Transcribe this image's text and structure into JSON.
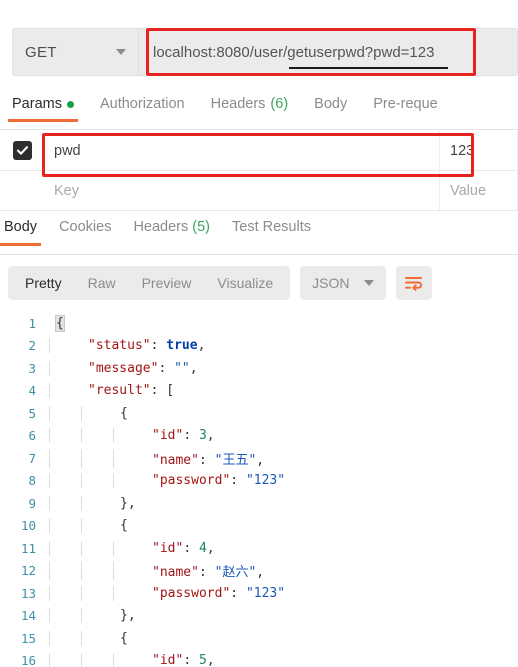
{
  "request": {
    "method": "GET",
    "method_caret_icon": "chevron-down-icon",
    "url": "localhost:8080/user/getuserpwd?pwd=123",
    "annotation_color": "#e8231f"
  },
  "request_tabs": [
    {
      "label": "Params",
      "badge": "",
      "dot": true,
      "active": true
    },
    {
      "label": "Authorization",
      "badge": "",
      "dot": false,
      "active": false
    },
    {
      "label": "Headers",
      "badge": "(6)",
      "dot": false,
      "active": false
    },
    {
      "label": "Body",
      "badge": "",
      "dot": false,
      "active": false
    },
    {
      "label": "Pre-reque",
      "badge": "",
      "dot": false,
      "active": false
    }
  ],
  "params": {
    "rows": [
      {
        "checked": true,
        "key": "pwd",
        "value": "123",
        "placeholder": false
      },
      {
        "checked": false,
        "key": "Key",
        "value": "Value",
        "placeholder": true
      }
    ]
  },
  "response_tabs": [
    {
      "label": "Body",
      "badge": "",
      "active": true
    },
    {
      "label": "Cookies",
      "badge": "",
      "active": false
    },
    {
      "label": "Headers",
      "badge": "(5)",
      "active": false
    },
    {
      "label": "Test Results",
      "badge": "",
      "active": false
    }
  ],
  "format_toolbar": {
    "views": [
      {
        "label": "Pretty",
        "active": true
      },
      {
        "label": "Raw",
        "active": false
      },
      {
        "label": "Preview",
        "active": false
      },
      {
        "label": "Visualize",
        "active": false
      }
    ],
    "language": "JSON",
    "language_caret_icon": "chevron-down-icon",
    "wrap_icon": "wrap-text-icon",
    "wrap_icon_color": "#ef6c35"
  },
  "code": {
    "lines": [
      {
        "n": "1",
        "indent": 0,
        "tokens": [
          {
            "t": "{",
            "c": "p",
            "hl": true
          }
        ]
      },
      {
        "n": "2",
        "indent": 1,
        "tokens": [
          {
            "t": "\"status\"",
            "c": "key"
          },
          {
            "t": ": ",
            "c": "p"
          },
          {
            "t": "true",
            "c": "bool"
          },
          {
            "t": ",",
            "c": "p"
          }
        ]
      },
      {
        "n": "3",
        "indent": 1,
        "tokens": [
          {
            "t": "\"message\"",
            "c": "key"
          },
          {
            "t": ": ",
            "c": "p"
          },
          {
            "t": "\"\"",
            "c": "str"
          },
          {
            "t": ",",
            "c": "p"
          }
        ]
      },
      {
        "n": "4",
        "indent": 1,
        "tokens": [
          {
            "t": "\"result\"",
            "c": "key"
          },
          {
            "t": ": ",
            "c": "p"
          },
          {
            "t": "[",
            "c": "p"
          }
        ]
      },
      {
        "n": "5",
        "indent": 2,
        "tokens": [
          {
            "t": "{",
            "c": "p"
          }
        ]
      },
      {
        "n": "6",
        "indent": 3,
        "tokens": [
          {
            "t": "\"id\"",
            "c": "key"
          },
          {
            "t": ": ",
            "c": "p"
          },
          {
            "t": "3",
            "c": "num"
          },
          {
            "t": ",",
            "c": "p"
          }
        ]
      },
      {
        "n": "7",
        "indent": 3,
        "tokens": [
          {
            "t": "\"name\"",
            "c": "key"
          },
          {
            "t": ": ",
            "c": "p"
          },
          {
            "t": "\"王五\"",
            "c": "str"
          },
          {
            "t": ",",
            "c": "p"
          }
        ]
      },
      {
        "n": "8",
        "indent": 3,
        "tokens": [
          {
            "t": "\"password\"",
            "c": "key"
          },
          {
            "t": ": ",
            "c": "p"
          },
          {
            "t": "\"123\"",
            "c": "str"
          }
        ]
      },
      {
        "n": "9",
        "indent": 2,
        "tokens": [
          {
            "t": "},",
            "c": "p"
          }
        ]
      },
      {
        "n": "10",
        "indent": 2,
        "tokens": [
          {
            "t": "{",
            "c": "p"
          }
        ]
      },
      {
        "n": "11",
        "indent": 3,
        "tokens": [
          {
            "t": "\"id\"",
            "c": "key"
          },
          {
            "t": ": ",
            "c": "p"
          },
          {
            "t": "4",
            "c": "num"
          },
          {
            "t": ",",
            "c": "p"
          }
        ]
      },
      {
        "n": "12",
        "indent": 3,
        "tokens": [
          {
            "t": "\"name\"",
            "c": "key"
          },
          {
            "t": ": ",
            "c": "p"
          },
          {
            "t": "\"赵六\"",
            "c": "str"
          },
          {
            "t": ",",
            "c": "p"
          }
        ]
      },
      {
        "n": "13",
        "indent": 3,
        "tokens": [
          {
            "t": "\"password\"",
            "c": "key"
          },
          {
            "t": ": ",
            "c": "p"
          },
          {
            "t": "\"123\"",
            "c": "str"
          }
        ]
      },
      {
        "n": "14",
        "indent": 2,
        "tokens": [
          {
            "t": "},",
            "c": "p"
          }
        ]
      },
      {
        "n": "15",
        "indent": 2,
        "tokens": [
          {
            "t": "{",
            "c": "p"
          }
        ]
      },
      {
        "n": "16",
        "indent": 3,
        "tokens": [
          {
            "t": "\"id\"",
            "c": "key"
          },
          {
            "t": ": ",
            "c": "p"
          },
          {
            "t": "5",
            "c": "num"
          },
          {
            "t": ",",
            "c": "p"
          }
        ]
      }
    ]
  }
}
